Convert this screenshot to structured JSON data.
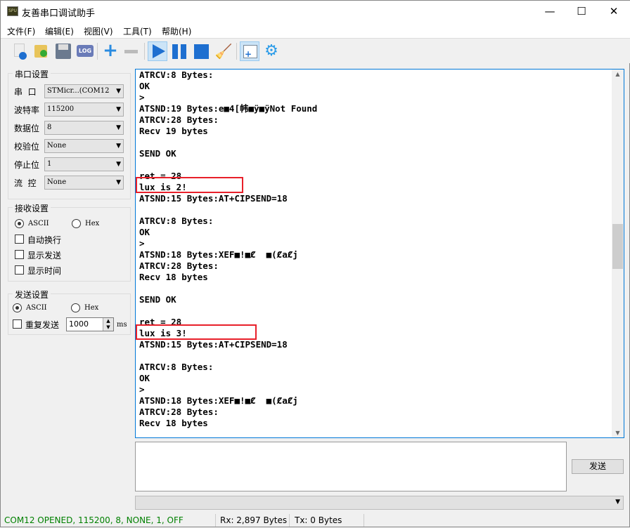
{
  "window": {
    "title": "友善串口调试助手",
    "minimize": "—",
    "maximize": "☐",
    "close": "✕",
    "icon_text": "SPU"
  },
  "menu": [
    "文件(F)",
    "编辑(E)",
    "视图(V)",
    "工具(T)",
    "帮助(H)"
  ],
  "toolbar": {
    "log_label": "LOG",
    "icons": [
      "new-file",
      "open-folder",
      "save",
      "log",
      "add",
      "remove",
      "play",
      "pause",
      "stop",
      "broom-clear",
      "add-window",
      "gear"
    ]
  },
  "serial_settings": {
    "title": "串口设置",
    "fields": [
      {
        "label": "串  口",
        "value": "STMicr...(COM12"
      },
      {
        "label": "波特率",
        "value": "115200"
      },
      {
        "label": "数据位",
        "value": "8"
      },
      {
        "label": "校验位",
        "value": "None"
      },
      {
        "label": "停止位",
        "value": "1"
      },
      {
        "label": "流  控",
        "value": "None"
      }
    ]
  },
  "receive_settings": {
    "title": "接收设置",
    "ascii": "ASCII",
    "hex": "Hex",
    "options": [
      "自动换行",
      "显示发送",
      "显示时间"
    ]
  },
  "send_settings": {
    "title": "发送设置",
    "ascii": "ASCII",
    "hex": "Hex",
    "repeat": "重复发送",
    "interval": "1000",
    "unit": "ms"
  },
  "output_lines": [
    "ATRCV:8 Bytes:",
    "OK",
    ">",
    "ATSND:19 Bytes:e■4[帏■ÿ■ÿNot Found",
    "ATRCV:28 Bytes:",
    "Recv 19 bytes",
    "",
    "SEND OK",
    "",
    "ret = 28",
    "lux is 2!",
    "ATSND:15 Bytes:AT+CIPSEND=18",
    "",
    "ATRCV:8 Bytes:",
    "OK",
    ">",
    "ATSND:18 Bytes:XEF■!■Ȼ  ■(ȻaȻj",
    "ATRCV:28 Bytes:",
    "Recv 18 bytes",
    "",
    "SEND OK",
    "",
    "ret = 28",
    "lux is 3!",
    "ATSND:15 Bytes:AT+CIPSEND=18",
    "",
    "ATRCV:8 Bytes:",
    "OK",
    ">",
    "ATSND:18 Bytes:XEF■!■Ȼ  ■(ȻaȻj",
    "ATRCV:28 Bytes:",
    "Recv 18 bytes"
  ],
  "send_button": "发送",
  "status": {
    "connection": "COM12 OPENED, 115200, 8, NONE, 1, OFF",
    "rx": "Rx: 2,897 Bytes",
    "tx": "Tx: 0 Bytes",
    "connection_color": "#008000"
  }
}
